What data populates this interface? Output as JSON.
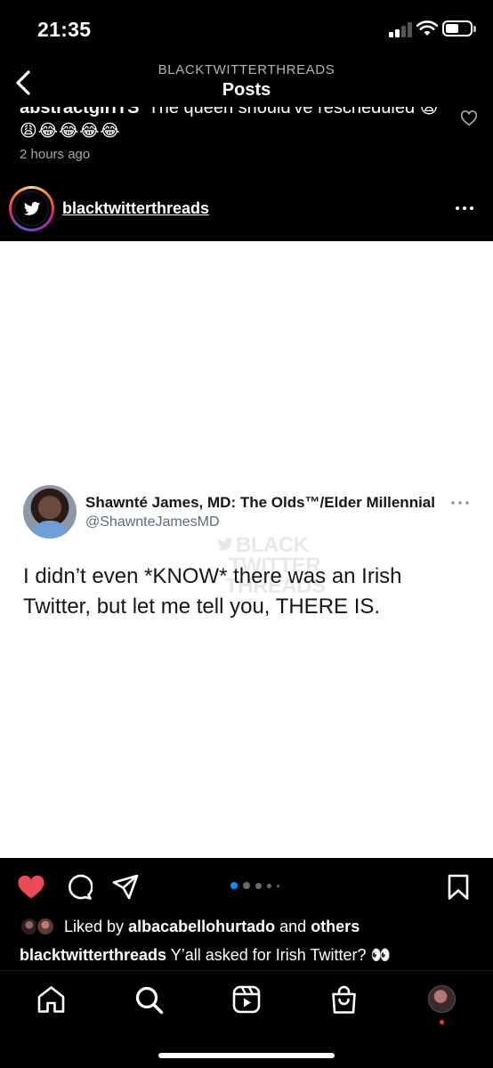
{
  "status_bar": {
    "time": "21:35",
    "icons": [
      "cellular-signal-icon",
      "wifi-icon",
      "battery-icon"
    ]
  },
  "header": {
    "account_caps": "BLACKTWITTERTHREADS",
    "title": "Posts",
    "back_icon": "chevron-left-icon"
  },
  "previous_comment": {
    "username": "abstractgirlTS",
    "text": "The queen should've rescheduled 😩",
    "emoji_line": "😩😂😂😂😂",
    "timestamp": "2 hours ago",
    "like_icon": "heart-outline-icon"
  },
  "post": {
    "username": "blacktwitterthreads",
    "avatar_icon": "twitter-bird-icon",
    "more_icon": "ellipsis-icon",
    "tweet": {
      "display_name": "Shawnté James, MD: The Olds™/Elder Millennial",
      "handle": "@ShawnteJamesMD",
      "text": "I didn’t even *KNOW* there was an Irish Twitter, but let me tell you, THERE IS.",
      "watermark_lines": [
        "BLACK",
        "TWITTER",
        "THREADS"
      ]
    },
    "carousel": {
      "count": 5,
      "active_index": 0
    },
    "liked_by": {
      "prefix": "Liked by",
      "user": "albacabellohurtado",
      "conjunction": "and",
      "suffix": "others"
    },
    "caption": {
      "username": "blacktwitterthreads",
      "text": "Y’all asked for Irish Twitter? 👀"
    }
  },
  "tab_bar": [
    "home-icon",
    "search-icon",
    "reels-icon",
    "shop-icon",
    "profile-avatar"
  ],
  "colors": {
    "background": "#000000",
    "like_red": "#ed4956",
    "carousel_active": "#0095f6",
    "secondary_text": "#a8a8a8"
  }
}
